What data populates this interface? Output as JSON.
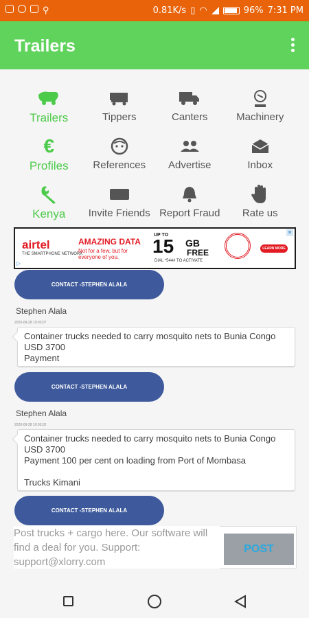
{
  "status": {
    "speed": "0.81K/s",
    "battery": "96%",
    "time": "7:31 PM"
  },
  "appbar": {
    "title": "Trailers"
  },
  "grid": [
    [
      {
        "label": "Trailers",
        "icon": "trailer-icon",
        "active": true
      },
      {
        "label": "Tippers",
        "icon": "truck-icon",
        "active": false
      },
      {
        "label": "Canters",
        "icon": "shipping-truck-icon",
        "active": false
      },
      {
        "label": "Machinery",
        "icon": "excavator-icon",
        "active": false
      }
    ],
    [
      {
        "label": "Profiles",
        "icon": "euro-icon",
        "active": true
      },
      {
        "label": "References",
        "icon": "face-icon",
        "active": false
      },
      {
        "label": "Advertise",
        "icon": "people-icon",
        "active": false
      },
      {
        "label": "Inbox",
        "icon": "envelope-icon",
        "active": false
      }
    ],
    [
      {
        "label": "Kenya",
        "icon": "wrench-icon",
        "active": true
      },
      {
        "label": "Invite Friends",
        "icon": "keyboard-icon",
        "active": false
      },
      {
        "label": "Report Fraud",
        "icon": "bell-icon",
        "active": false
      },
      {
        "label": "Rate us",
        "icon": "hand-icon",
        "active": false
      }
    ]
  ],
  "ad": {
    "brand": "airtel",
    "tagline": "THE SMARTPHONE NETWORK",
    "headline": "AMAZING DATA",
    "sub": "Not for a few, but for everyone of you.",
    "upto": "UP TO",
    "amount": "15",
    "unit": "GB",
    "free": "FREE",
    "dial": "DIAL *544# TO ACTIVATE",
    "cta": "LEARN MORE >>"
  },
  "posts": [
    {
      "contact": "CONTACT -STEPHEN ALALA",
      "name": "Stephen Alala",
      "date": "2020-09-28 10:03:07",
      "lines": [
        "Container trucks needed to carry mosquito nets to Bunia Congo",
        "USD 3700",
        "Payment"
      ]
    },
    {
      "contact": "CONTACT -STEPHEN ALALA",
      "name": "Stephen Alala",
      "date": "2020-09-28 10:03:02",
      "lines": [
        "Container trucks needed to carry mosquito nets to Bunia Congo",
        "USD 3700",
        "Payment 100 per cent on loading from Port of Mombasa",
        "",
        "Trucks Kimani"
      ]
    }
  ],
  "last_contact": "CONTACT -STEPHEN ALALA",
  "input": {
    "placeholder": "Post trucks + cargo here. Our software will find a deal for you. Support: support@xlorry.com",
    "post_label": "POST"
  },
  "colors": {
    "status": "#e8630a",
    "appbar": "#5fd35b",
    "accent": "#4ccb4a",
    "contact": "#3e5a9c"
  }
}
